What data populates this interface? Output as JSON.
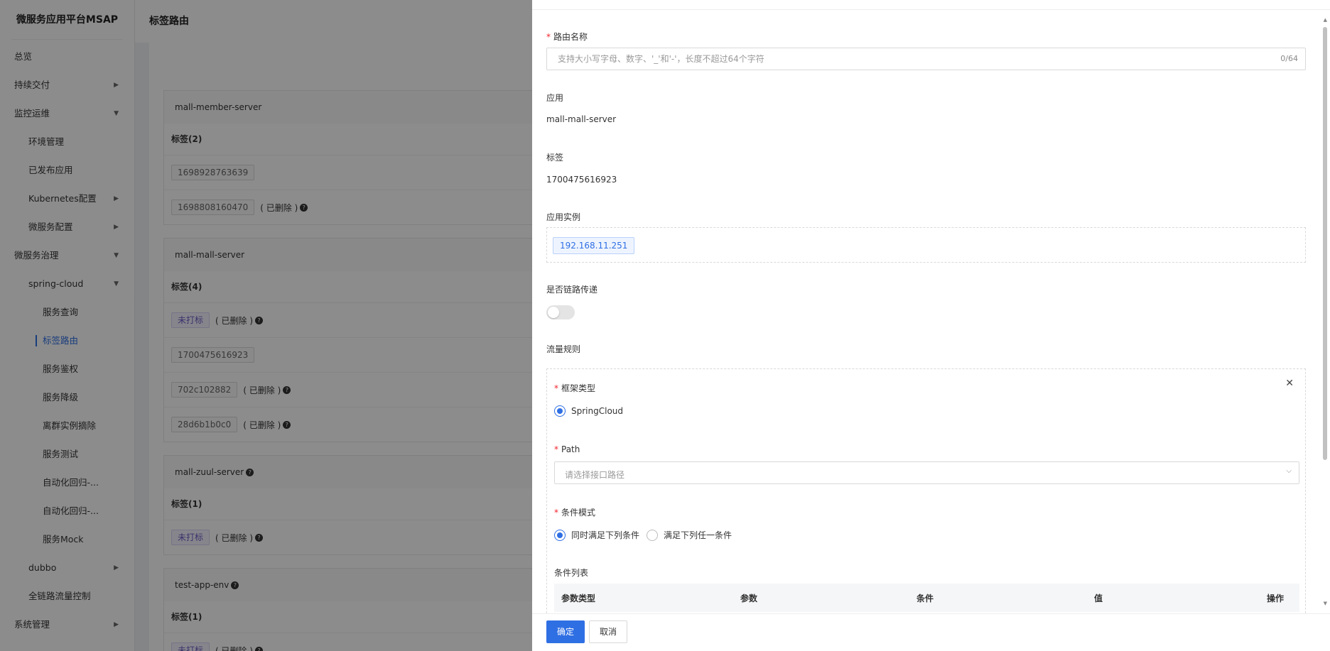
{
  "sidebar": {
    "brand": "微服务应用平台MSAP",
    "items": [
      {
        "label": "总览",
        "level": 1,
        "arrow": ""
      },
      {
        "label": "持续交付",
        "level": 1,
        "arrow": "▶"
      },
      {
        "label": "监控运维",
        "level": 1,
        "arrow": "▼"
      },
      {
        "label": "环境管理",
        "level": 2,
        "arrow": ""
      },
      {
        "label": "已发布应用",
        "level": 2,
        "arrow": ""
      },
      {
        "label": "Kubernetes配置",
        "level": 2,
        "arrow": "▶"
      },
      {
        "label": "微服务配置",
        "level": 2,
        "arrow": "▶"
      },
      {
        "label": "微服务治理",
        "level": 1,
        "arrow": "▼"
      },
      {
        "label": "spring-cloud",
        "level": 2,
        "arrow": "▼"
      },
      {
        "label": "服务查询",
        "level": 3,
        "arrow": ""
      },
      {
        "label": "标签路由",
        "level": 3,
        "arrow": "",
        "active": true
      },
      {
        "label": "服务鉴权",
        "level": 3,
        "arrow": ""
      },
      {
        "label": "服务降级",
        "level": 3,
        "arrow": ""
      },
      {
        "label": "离群实例摘除",
        "level": 3,
        "arrow": ""
      },
      {
        "label": "服务测试",
        "level": 3,
        "arrow": ""
      },
      {
        "label": "自动化回归-...",
        "level": 3,
        "arrow": ""
      },
      {
        "label": "自动化回归-...",
        "level": 3,
        "arrow": ""
      },
      {
        "label": "服务Mock",
        "level": 3,
        "arrow": ""
      },
      {
        "label": "dubbo",
        "level": 2,
        "arrow": "▶"
      },
      {
        "label": "全链路流量控制",
        "level": 2,
        "arrow": ""
      },
      {
        "label": "系统管理",
        "level": 1,
        "arrow": "▶"
      }
    ]
  },
  "main": {
    "title": "标签路由",
    "apps": [
      {
        "name": "mall-member-server",
        "help": false,
        "tag_count": "标签(2)",
        "tags": [
          {
            "label": "1698928763639",
            "untagged": false,
            "deleted": ""
          },
          {
            "label": "1698808160470",
            "untagged": false,
            "deleted": "( 已删除 )"
          }
        ]
      },
      {
        "name": "mall-mall-server",
        "help": false,
        "tag_count": "标签(4)",
        "tags": [
          {
            "label": "未打标",
            "untagged": true,
            "deleted": "( 已删除 )"
          },
          {
            "label": "1700475616923",
            "untagged": false,
            "deleted": ""
          },
          {
            "label": "702c102882",
            "untagged": false,
            "deleted": "( 已删除 )"
          },
          {
            "label": "28d6b1b0c0",
            "untagged": false,
            "deleted": "( 已删除 )"
          }
        ]
      },
      {
        "name": "mall-zuul-server",
        "help": true,
        "tag_count": "标签(1)",
        "tags": [
          {
            "label": "未打标",
            "untagged": true,
            "deleted": "( 已删除 )"
          }
        ]
      },
      {
        "name": "test-app-env",
        "help": true,
        "tag_count": "标签(1)",
        "tags": [
          {
            "label": "未打标",
            "untagged": true,
            "deleted": "( 已删除 )"
          }
        ]
      }
    ]
  },
  "drawer": {
    "route_name_label": "路由名称",
    "route_name_placeholder": "支持大小写字母、数字、'_'和'-'，长度不超过64个字符",
    "route_name_counter": "0/64",
    "app_label": "应用",
    "app_value": "mall-mall-server",
    "tag_label": "标签",
    "tag_value": "1700475616923",
    "instance_label": "应用实例",
    "instance_ip": "192.168.11.251",
    "trace_label": "是否链路传递",
    "traffic_rule_label": "流量规则",
    "rule": {
      "framework_label": "框架类型",
      "framework_option": "SpringCloud",
      "path_label": "Path",
      "path_placeholder": "请选择接口路径",
      "condition_mode_label": "条件模式",
      "mode_all": "同时满足下列条件",
      "mode_any": "满足下列任一条件",
      "condition_list_label": "条件列表",
      "columns": [
        "参数类型",
        "参数",
        "条件",
        "值",
        "操作"
      ]
    },
    "confirm": "确定",
    "cancel": "取消"
  }
}
